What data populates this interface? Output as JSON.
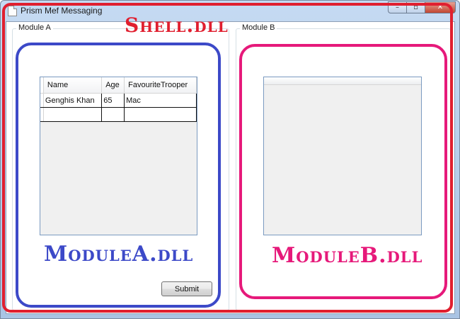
{
  "window": {
    "title": "Prism Mef Messaging",
    "caption_buttons": {
      "minimize": "–",
      "maximize": "▫",
      "close": "✕"
    }
  },
  "module_a": {
    "group_label": "Module A",
    "grid": {
      "columns": [
        "Name",
        "Age",
        "FavouriteTrooper"
      ],
      "rows": [
        [
          "Genghis Khan",
          "65",
          "Mac"
        ],
        [
          "",
          "",
          ""
        ]
      ]
    },
    "submit_label": "Submit"
  },
  "module_b": {
    "group_label": "Module B"
  },
  "annotations": {
    "shell": "Shell.dll",
    "module_a": "ModuleA.dll",
    "module_b": "ModuleB.dll"
  },
  "colors": {
    "shell_frame": "#e01f2f",
    "module_a_frame": "#3c49c8",
    "module_b_frame": "#e6197a"
  }
}
